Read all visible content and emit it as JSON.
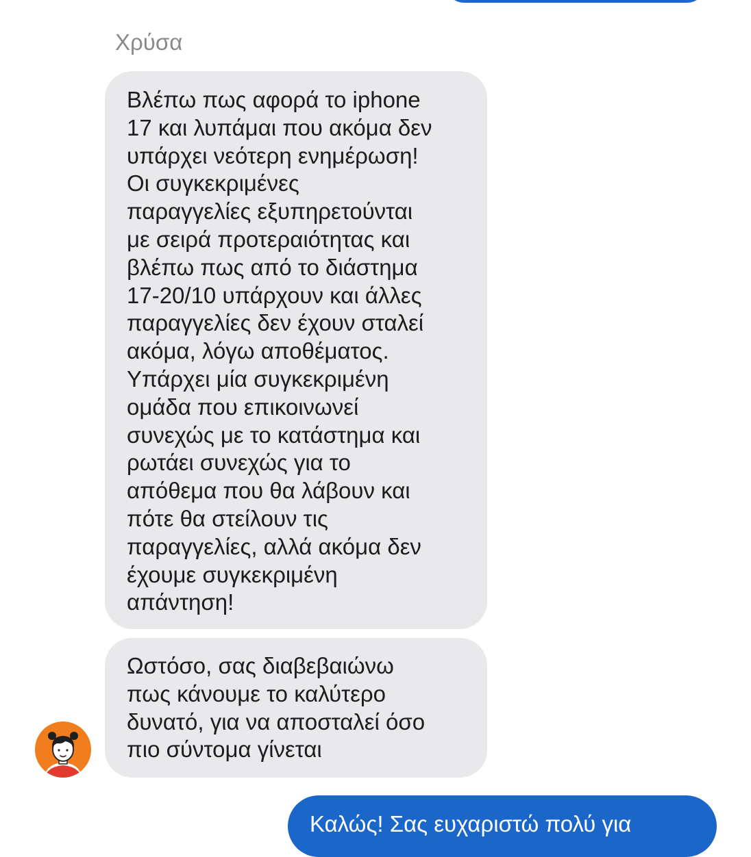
{
  "conversation": {
    "agent_name": "Χρύσα",
    "messages": [
      {
        "direction": "incoming",
        "text": "Βλέπω πως αφορά το iphone\n17 και λυπάμαι που ακόμα δεν\nυπάρχει νεότερη ενημέρωση!\nΟι συγκεκριμένες\nπαραγγελίες εξυπηρετούνται\nμε σειρά προτεραιότητας και\nβλέπω πως από το διάστημα\n17-20/10 υπάρχουν και άλλες\nπαραγγελίες δεν έχουν σταλεί\nακόμα, λόγω αποθέματος.\nΥπάρχει μία συγκεκριμένη\nομάδα που επικοινωνεί\nσυνεχώς με το κατάστημα και\nρωτάει συνεχώς για το\nαπόθεμα που θα λάβουν και\nπότε θα στείλουν τις\nπαραγγελίες, αλλά ακόμα δεν\nέχουμε συγκεκριμένη\nαπάντηση!"
      },
      {
        "direction": "incoming",
        "text": "Ωστόσο, σας διαβεβαιώνω\nπως κάνουμε το καλύτερο\nδυνατό, για να αποσταλεί όσο\nπιο σύντομα γίνεται"
      },
      {
        "direction": "outgoing",
        "text": "Καλώς! Σας ευχαριστώ πολύ για"
      }
    ],
    "avatar_icon": "girl-avatar-icon"
  },
  "colors": {
    "incoming_bubble": "#e9e9eb",
    "outgoing_bubble": "#1b66c9",
    "sender_name": "#8a8a8e",
    "avatar_background": "#f07d1e"
  }
}
